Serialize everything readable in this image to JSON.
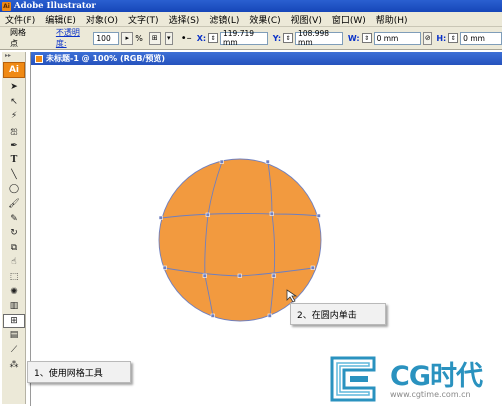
{
  "window": {
    "app_icon_text": "Ai",
    "title": "Adobe Illustrator"
  },
  "menubar": {
    "items": [
      "文件(F)",
      "编辑(E)",
      "对象(O)",
      "文字(T)",
      "选择(S)",
      "滤镜(L)",
      "效果(C)",
      "视图(V)",
      "窗口(W)",
      "帮助(H)"
    ]
  },
  "control_bar": {
    "tool_label": "网格点",
    "opacity_label": "不透明度:",
    "opacity_value": "100",
    "opacity_unit": "%",
    "x_label": "X:",
    "x_value": "119.719 mm",
    "y_label": "Y:",
    "y_value": "108.998 mm",
    "w_label": "W:",
    "w_value": "0 mm",
    "h_label": "H:",
    "h_value": "0 mm"
  },
  "toolbox": {
    "logo": "Ai",
    "tools": [
      "selection-tool",
      "direct-selection-tool",
      "magic-wand-tool",
      "lasso-tool",
      "pen-tool",
      "type-tool",
      "line-tool",
      "ellipse-tool",
      "paintbrush-tool",
      "pencil-tool",
      "rotate-tool",
      "scale-tool",
      "warp-tool",
      "free-transform-tool",
      "symbol-sprayer-tool",
      "column-graph-tool",
      "mesh-tool",
      "gradient-tool",
      "eyedropper-tool",
      "blend-tool"
    ],
    "active_tool": "mesh-tool"
  },
  "document": {
    "tab_title": "未标题-1 @ 100% (RGB/预览)"
  },
  "artwork": {
    "fill_color": "#f29a3f",
    "mesh_color": "#6e7fc0"
  },
  "callouts": {
    "step1": "1、使用网格工具",
    "step2": "2、在圆内单击"
  },
  "watermark": {
    "brand": "CG时代",
    "url": "www.cgtime.com.cn"
  }
}
